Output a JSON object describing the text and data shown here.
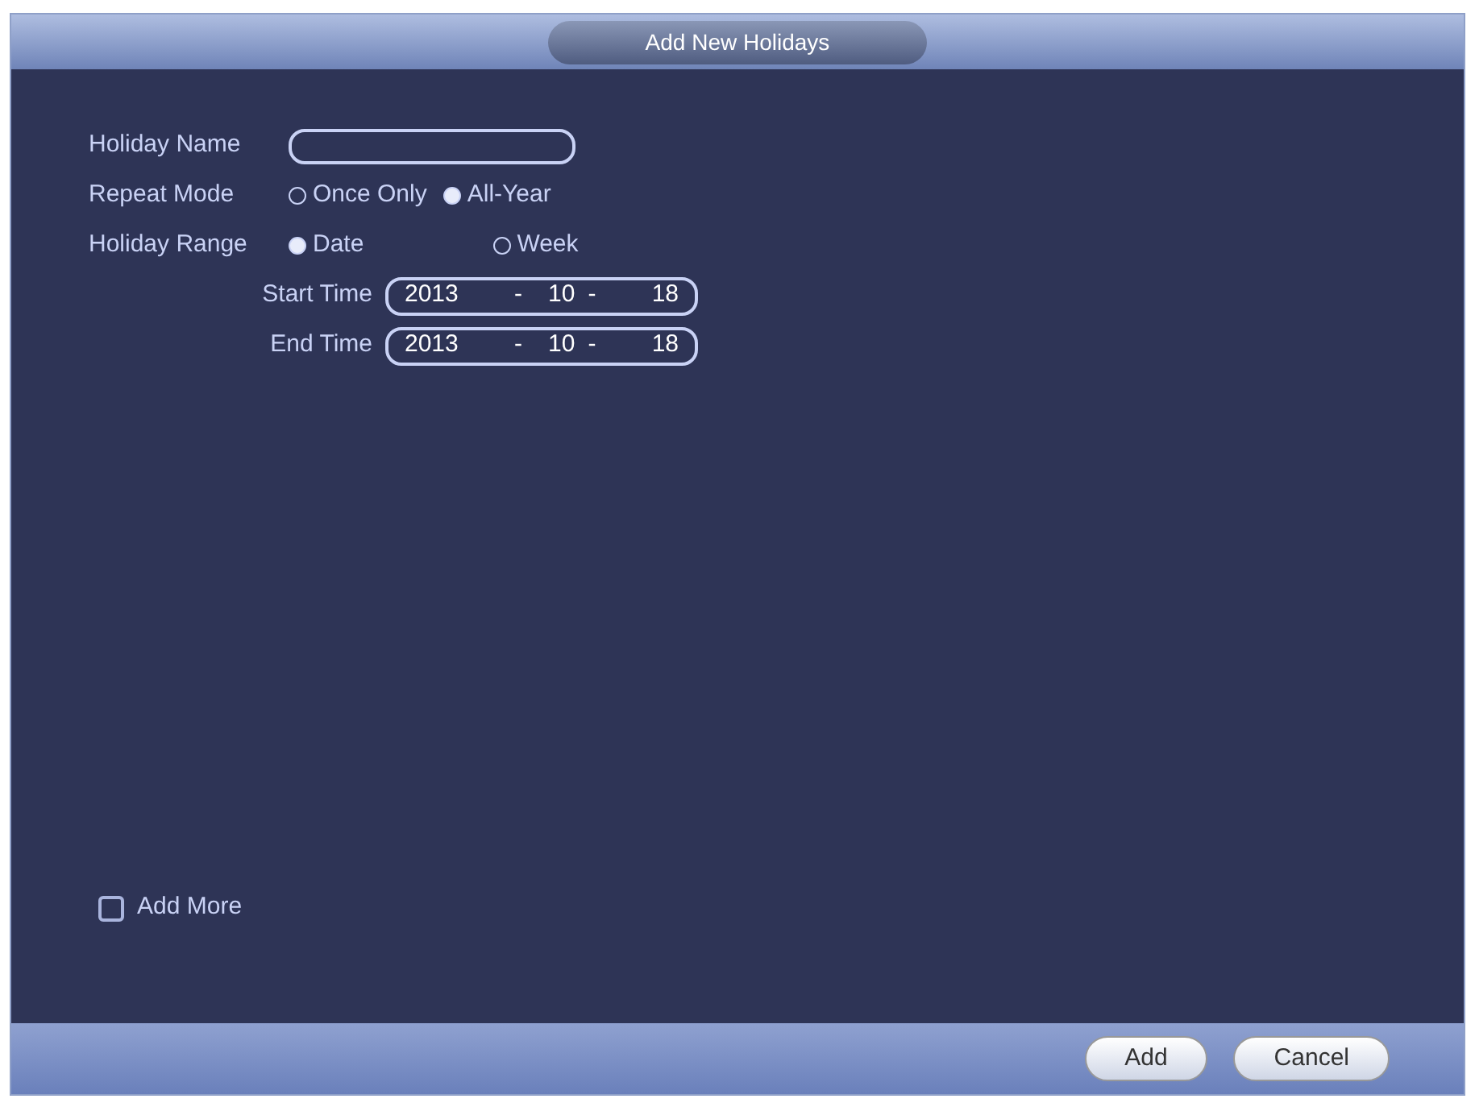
{
  "window": {
    "title": "Add New Holidays"
  },
  "holiday_name": {
    "label": "Holiday Name"
  },
  "repeat_mode": {
    "label": "Repeat Mode",
    "options": [
      {
        "label": "Once Only",
        "selected": false
      },
      {
        "label": "All-Year",
        "selected": true
      }
    ]
  },
  "holiday_range": {
    "label": "Holiday Range",
    "options": [
      {
        "label": "Date",
        "selected": true
      },
      {
        "label": "Week",
        "selected": false
      }
    ]
  },
  "dates": [
    {
      "label": "Start Time",
      "year": "2013",
      "separator_1": "-",
      "month": "10",
      "separator_2": "-",
      "day": "18"
    },
    {
      "label": "End Time",
      "year": "2013",
      "separator_1": "-",
      "month": "10",
      "separator_2": "-",
      "day": "18"
    }
  ],
  "add_more": {
    "label": "Add More",
    "checked": false
  },
  "buttons": [
    {
      "label": "Add"
    },
    {
      "label": "Cancel"
    }
  ]
}
